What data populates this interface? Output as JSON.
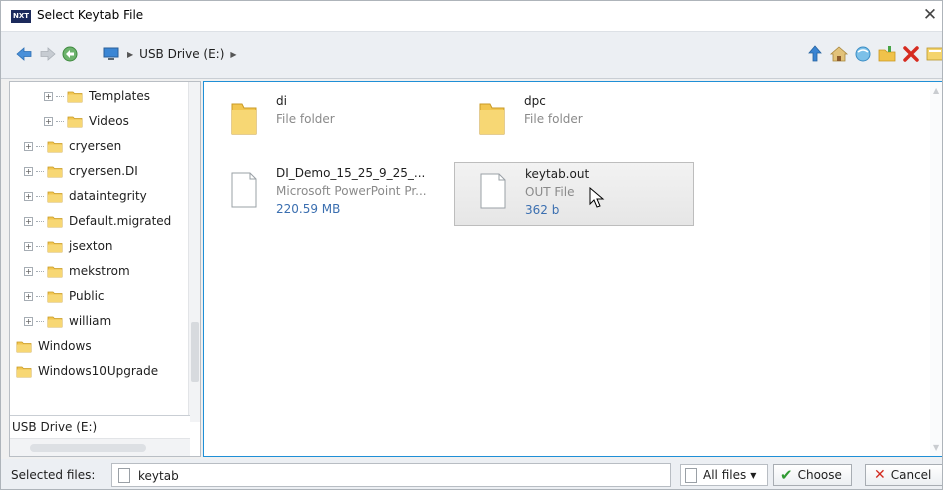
{
  "window": {
    "title": "Select Keytab File",
    "app_logo_text": "NXT"
  },
  "toolbar": {
    "path": [
      "USB Drive (E:)"
    ]
  },
  "tree": {
    "items": [
      {
        "label": "Templates",
        "level": 2
      },
      {
        "label": "Videos",
        "level": 2
      },
      {
        "label": "cryersen",
        "level": 1
      },
      {
        "label": "cryersen.DI",
        "level": 1
      },
      {
        "label": "dataintegrity",
        "level": 1
      },
      {
        "label": "Default.migrated",
        "level": 1
      },
      {
        "label": "jsexton",
        "level": 1
      },
      {
        "label": "mekstrom",
        "level": 1
      },
      {
        "label": "Public",
        "level": 1
      },
      {
        "label": "william",
        "level": 1
      },
      {
        "label": "Windows",
        "level": 0
      },
      {
        "label": "Windows10Upgrade",
        "level": 0
      }
    ],
    "current_location": "USB Drive (E:)"
  },
  "files": [
    {
      "name": "di",
      "type": "File folder",
      "size": "",
      "kind": "folder"
    },
    {
      "name": "dpc",
      "type": "File folder",
      "size": "",
      "kind": "folder"
    },
    {
      "name": "DI_Demo_15_25_9_25_...",
      "type": "Microsoft PowerPoint Pr...",
      "size": "220.59 MB",
      "kind": "file"
    },
    {
      "name": "keytab.out",
      "type": "OUT File",
      "size": "362 b",
      "kind": "file",
      "selected": true
    }
  ],
  "bottom": {
    "selected_label": "Selected files:",
    "selected_value": "keytab",
    "filter_label": "All files",
    "choose_label": "Choose",
    "cancel_label": "Cancel"
  },
  "colors": {
    "accent_border": "#1f8fd6",
    "size_text": "#3b6fb0",
    "choose_check": "#2f9a32",
    "cancel_x": "#d22a1f"
  }
}
